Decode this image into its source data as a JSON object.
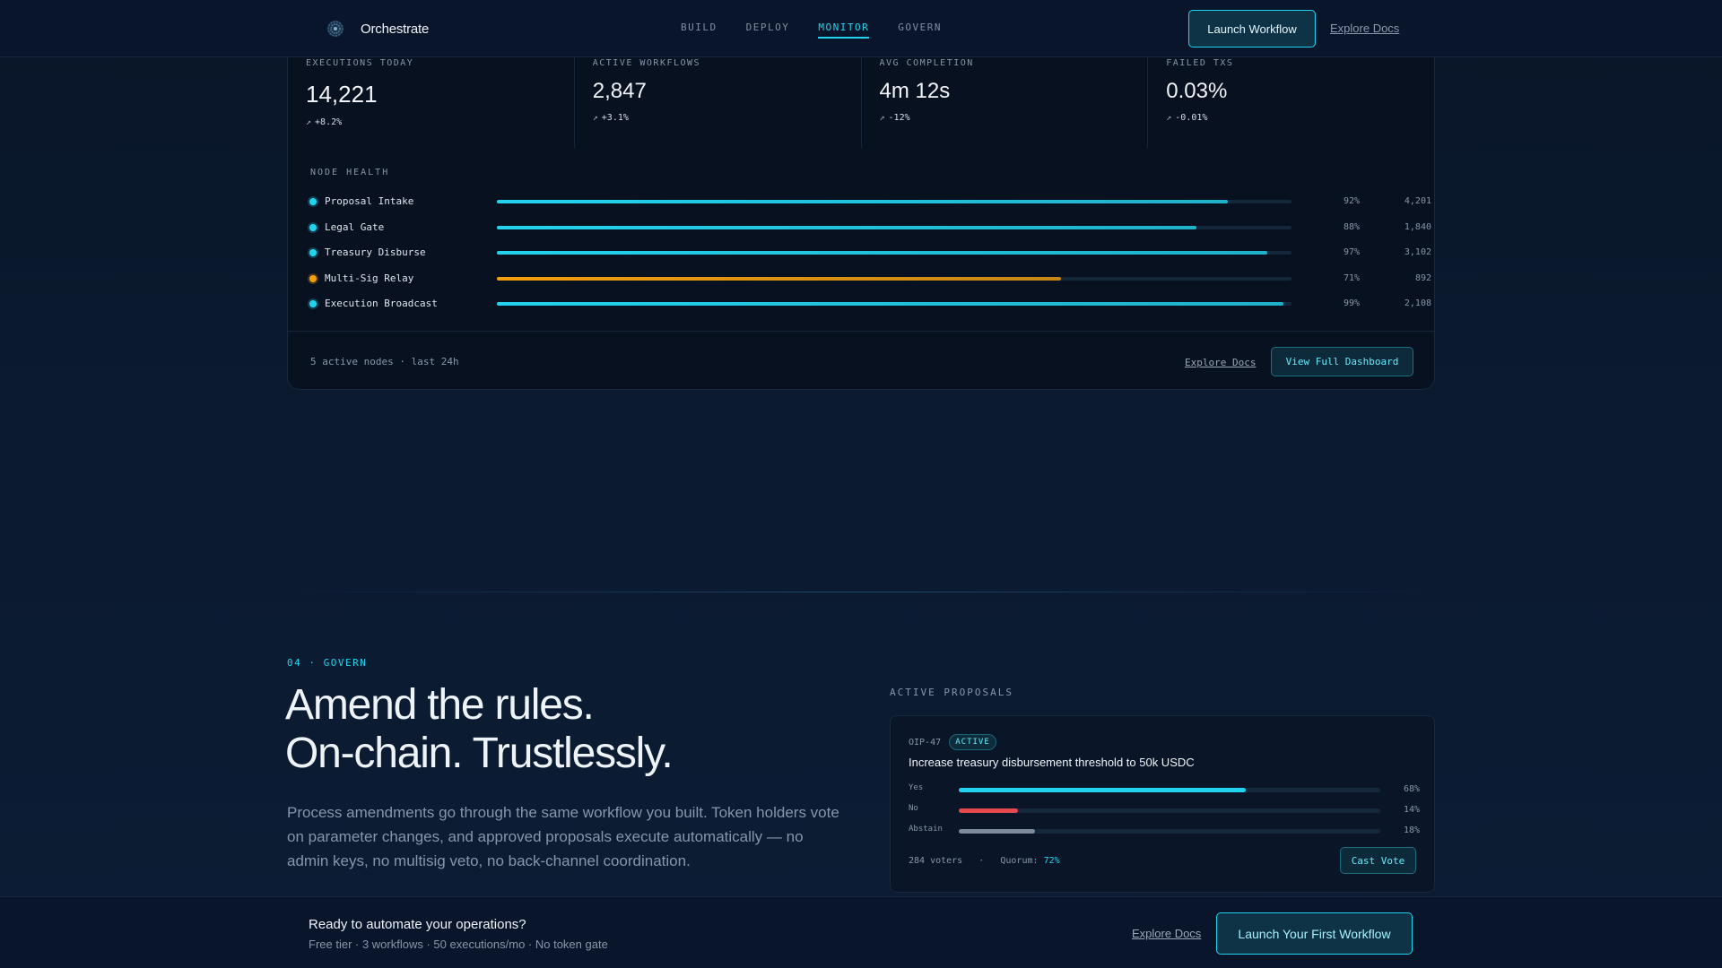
{
  "nav": {
    "brand": "Orchestrate",
    "brand_icon": "orchestrate-logo-icon",
    "links": [
      "BUILD",
      "DEPLOY",
      "MONITOR",
      "GOVERN"
    ],
    "active_link": "MONITOR",
    "cta": "Launch Workflow",
    "docs": "Explore Docs"
  },
  "stats": [
    {
      "label": "EXECUTIONS TODAY",
      "value": "14,221",
      "delta": "+8.2%"
    },
    {
      "label": "ACTIVE WORKFLOWS",
      "value": "2,847",
      "delta": "+3.1%"
    },
    {
      "label": "AVG COMPLETION",
      "value": "4m 12s",
      "delta": "-12%"
    },
    {
      "label": "FAILED TXS",
      "value": "0.03%",
      "delta": "-0.01%"
    }
  ],
  "node_health": {
    "title": "NODE HEALTH",
    "nodes": [
      {
        "name": "Proposal Intake",
        "pct": "92%",
        "fill": 0.92,
        "count": "4,201",
        "status": "healthy"
      },
      {
        "name": "Legal Gate",
        "pct": "88%",
        "fill": 0.88,
        "count": "1,840",
        "status": "healthy"
      },
      {
        "name": "Treasury Disburse",
        "pct": "97%",
        "fill": 0.97,
        "count": "3,102",
        "status": "healthy"
      },
      {
        "name": "Multi-Sig Relay",
        "pct": "71%",
        "fill": 0.71,
        "count": "892",
        "status": "warning"
      },
      {
        "name": "Execution Broadcast",
        "pct": "99%",
        "fill": 0.99,
        "count": "2,108",
        "status": "healthy"
      }
    ],
    "footer_text": "5 active nodes · last 24h",
    "docs": "Explore Docs",
    "cta": "View Full Dashboard"
  },
  "govern": {
    "eyebrow": "04 · GOVERN",
    "headline_line1": "Amend the rules.",
    "headline_line2": "On-chain. Trustlessly.",
    "body": "Process amendments go through the same workflow you built. Token holders vote on parameter changes, and approved proposals execute automatically — no admin keys, no multisig veto, no back-channel coordination.",
    "proposals_label": "ACTIVE PROPOSALS",
    "proposal": {
      "id": "OIP-47",
      "badge": "ACTIVE",
      "title": "Increase treasury disbursement threshold to 50k USDC",
      "votes": [
        {
          "label": "Yes",
          "pct": "68%",
          "fill": 0.68,
          "color": "#22d3ee"
        },
        {
          "label": "No",
          "pct": "14%",
          "fill": 0.14,
          "color": "#e5484d"
        },
        {
          "label": "Abstain",
          "pct": "18%",
          "fill": 0.18,
          "color": "#7d8a9c"
        }
      ],
      "voters": "284 voters",
      "separator": "·",
      "quorum_label": "Quorum:",
      "quorum_value": "72%",
      "cta": "Cast Vote"
    }
  },
  "cta_bar": {
    "title": "Ready to automate your operations?",
    "subtitle": "Free tier · 3 workflows · 50 executions/mo · No token gate",
    "docs": "Explore Docs",
    "cta": "Launch Your First Workflow"
  },
  "colors": {
    "accent": "#22d3ee",
    "warning": "#f59e0b",
    "danger": "#e5484d"
  }
}
